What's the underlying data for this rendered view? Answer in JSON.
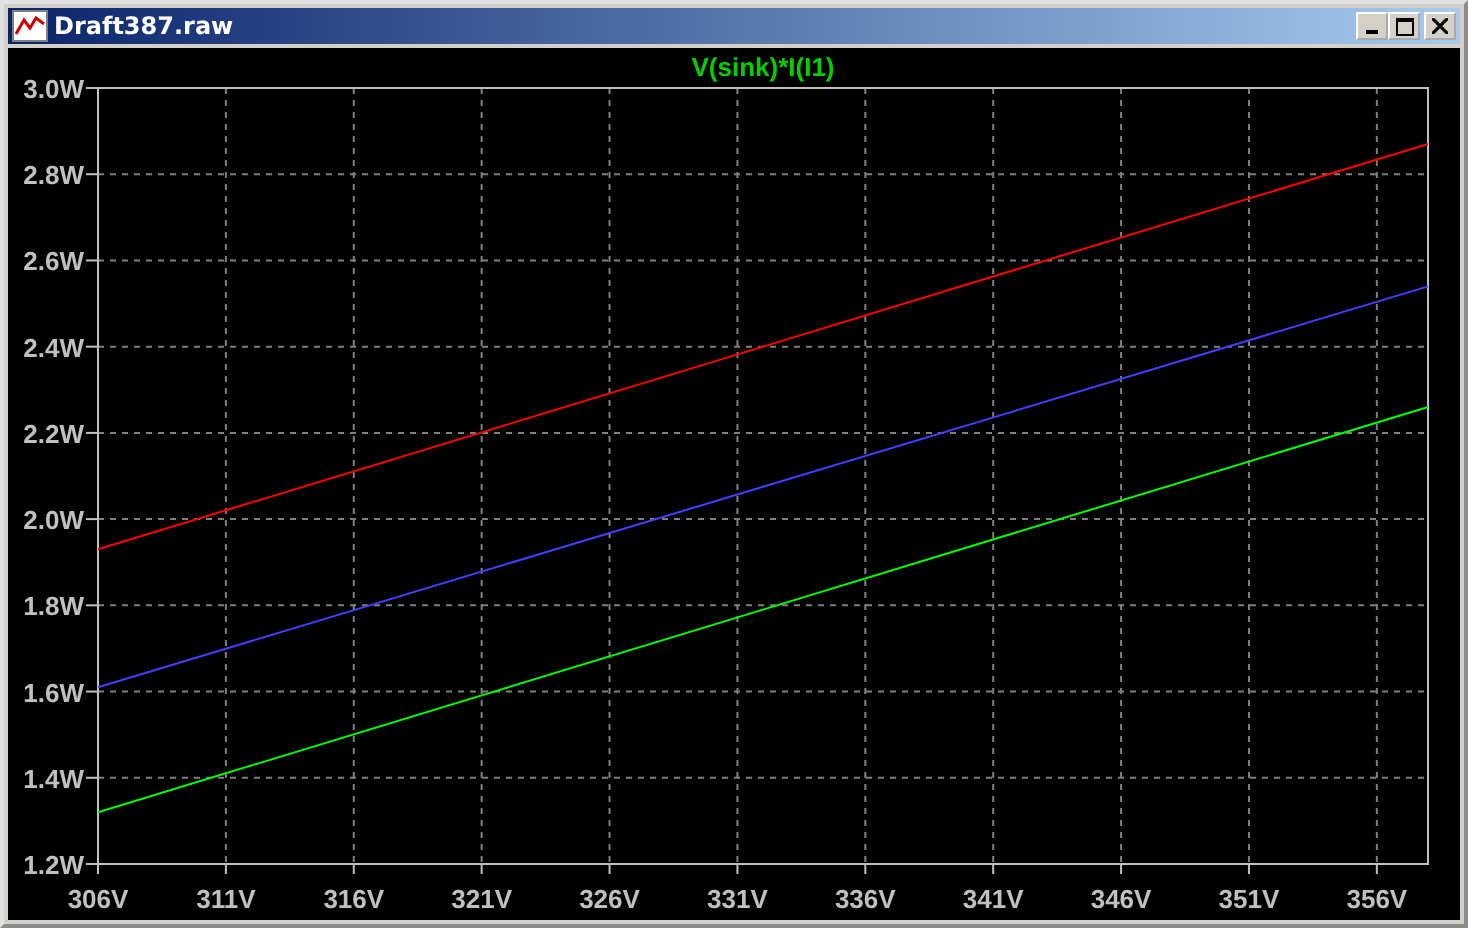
{
  "window": {
    "title": "Draft387.raw"
  },
  "plot": {
    "chart_data": {
      "type": "line",
      "title": "V(sink)*I(I1)",
      "x": [
        306,
        332,
        358
      ],
      "series": [
        {
          "color": "#ff0000",
          "values": [
            1.93,
            2.4,
            2.87
          ]
        },
        {
          "color": "#4040ff",
          "values": [
            1.61,
            2.075,
            2.54
          ]
        },
        {
          "color": "#00ff00",
          "values": [
            1.32,
            1.79,
            2.26
          ]
        }
      ],
      "grid": true,
      "xlim": [
        306,
        358
      ],
      "ylim": [
        1.2,
        3.0
      ],
      "xticks": [
        {
          "value": 306,
          "label": "306V"
        },
        {
          "value": 311,
          "label": "311V"
        },
        {
          "value": 316,
          "label": "316V"
        },
        {
          "value": 321,
          "label": "321V"
        },
        {
          "value": 326,
          "label": "326V"
        },
        {
          "value": 331,
          "label": "331V"
        },
        {
          "value": 336,
          "label": "336V"
        },
        {
          "value": 341,
          "label": "341V"
        },
        {
          "value": 346,
          "label": "346V"
        },
        {
          "value": 351,
          "label": "351V"
        },
        {
          "value": 356,
          "label": "356V"
        }
      ],
      "yticks": [
        {
          "value": 1.2,
          "label": "1.2W"
        },
        {
          "value": 1.4,
          "label": "1.4W"
        },
        {
          "value": 1.6,
          "label": "1.6W"
        },
        {
          "value": 1.8,
          "label": "1.8W"
        },
        {
          "value": 2.0,
          "label": "2.0W"
        },
        {
          "value": 2.2,
          "label": "2.2W"
        },
        {
          "value": 2.4,
          "label": "2.4W"
        },
        {
          "value": 2.6,
          "label": "2.6W"
        },
        {
          "value": 2.8,
          "label": "2.8W"
        },
        {
          "value": 3.0,
          "label": "3.0W"
        }
      ]
    }
  }
}
